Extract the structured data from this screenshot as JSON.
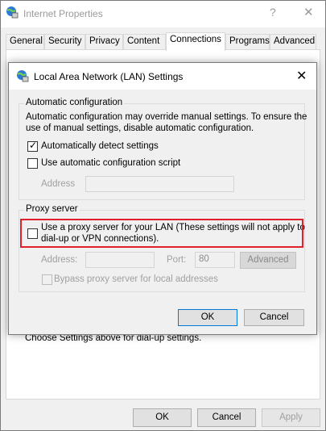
{
  "outer_window": {
    "title": "Internet Properties",
    "help_glyph": "?",
    "close_glyph": "✕",
    "tabs": [
      {
        "label": "General"
      },
      {
        "label": "Security"
      },
      {
        "label": "Privacy"
      },
      {
        "label": "Content"
      },
      {
        "label": "Connections"
      },
      {
        "label": "Programs"
      },
      {
        "label": "Advanced"
      }
    ],
    "active_tab": "Connections",
    "dialup_hint": "Choose Settings above for dial-up settings.",
    "footer": {
      "ok": "OK",
      "cancel": "Cancel",
      "apply": "Apply"
    }
  },
  "lan_dialog": {
    "title": "Local Area Network (LAN) Settings",
    "close_glyph": "✕",
    "auto_config": {
      "group_label": "Automatic configuration",
      "description": [
        "Automatic configuration may override manual settings.  To ensure the",
        "use of manual settings, disable automatic configuration."
      ],
      "auto_detect": {
        "label": "Automatically detect settings",
        "checked": true
      },
      "auto_script": {
        "label": "Use automatic configuration script",
        "checked": false
      },
      "address_label": "Address",
      "address_value": ""
    },
    "proxy": {
      "group_label": "Proxy server",
      "use_proxy": {
        "label_lines": [
          "Use a proxy server for your LAN (These settings will not apply to",
          "dial-up or VPN connections)."
        ],
        "checked": false
      },
      "address_label": "Address:",
      "address_value": "",
      "port_label": "Port:",
      "port_value": "80",
      "advanced_label": "Advanced",
      "bypass": {
        "label": "Bypass proxy server for local addresses",
        "checked": false
      }
    },
    "footer": {
      "ok": "OK",
      "cancel": "Cancel"
    }
  },
  "colors": {
    "highlight": "#e0202a",
    "default_button_border": "#0078d7",
    "icon_globe": "#2b7bd6"
  }
}
